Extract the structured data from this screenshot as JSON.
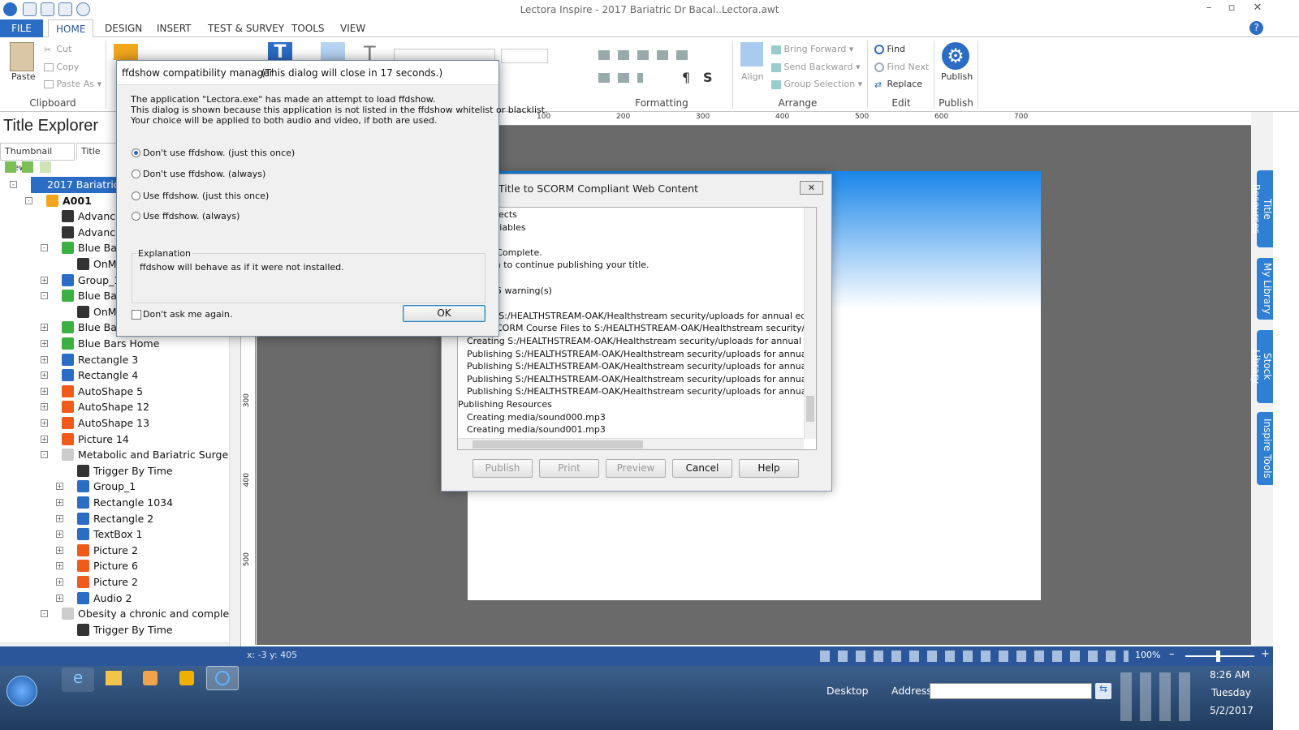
{
  "app": {
    "title": "Lectora Inspire - 2017 Bariatric Dr Bacal..Lectora.awt"
  },
  "window_buttons": {
    "minimize": "–",
    "restore": "▫",
    "close": "✕",
    "help": "?"
  },
  "tabs": [
    "FILE",
    "HOME",
    "DESIGN",
    "INSERT",
    "TEST & SURVEY",
    "TOOLS",
    "VIEW"
  ],
  "ribbon": {
    "clipboard": {
      "label": "Clipboard",
      "paste": "Paste",
      "cut": "Cut",
      "copy": "Copy",
      "paste_as": "Paste As"
    },
    "formatting": {
      "label": "Formatting"
    },
    "arrange": {
      "label": "Arrange",
      "align": "Align",
      "bring_forward": "Bring Forward",
      "send_backward": "Send Backward",
      "group_selection": "Group Selection"
    },
    "edit": {
      "label": "Edit",
      "find": "Find",
      "find_next": "Find Next",
      "replace": "Replace"
    },
    "publish": {
      "label": "Publish",
      "button": "Publish"
    }
  },
  "explorer": {
    "title": "Title Explorer",
    "tabs": [
      "Thumbnail View",
      "Title Expl"
    ],
    "tree": [
      {
        "label": "2017 Bariatric",
        "icon": "book",
        "selected": true
      },
      {
        "label": "A001",
        "icon": "folder",
        "bold": true
      },
      {
        "label": "Advance",
        "icon": "clapper"
      },
      {
        "label": "Advance",
        "icon": "clapper"
      },
      {
        "label": "Blue Bar",
        "icon": "green-screen"
      },
      {
        "label": "OnM",
        "icon": "clapper"
      },
      {
        "label": "Group_1",
        "icon": "group"
      },
      {
        "label": "Blue Bar",
        "icon": "green-screen"
      },
      {
        "label": "OnM",
        "icon": "clapper"
      },
      {
        "label": "Blue Bar",
        "icon": "green-screen"
      },
      {
        "label": "Blue Bars Home",
        "icon": "green-screen"
      },
      {
        "label": "Rectangle 3",
        "icon": "text"
      },
      {
        "label": "Rectangle 4",
        "icon": "text"
      },
      {
        "label": "AutoShape 5",
        "icon": "image"
      },
      {
        "label": "AutoShape 12",
        "icon": "image"
      },
      {
        "label": "AutoShape 13",
        "icon": "image"
      },
      {
        "label": "Picture 14",
        "icon": "image"
      },
      {
        "label": "Metabolic and Bariatric Surgery",
        "icon": "page"
      },
      {
        "label": "Trigger By Time",
        "icon": "clapper"
      },
      {
        "label": "Group_1",
        "icon": "group"
      },
      {
        "label": "Rectangle 1034",
        "icon": "text"
      },
      {
        "label": "Rectangle 2",
        "icon": "text"
      },
      {
        "label": "TextBox 1",
        "icon": "text"
      },
      {
        "label": "Picture 2",
        "icon": "image"
      },
      {
        "label": "Picture 6",
        "icon": "image"
      },
      {
        "label": "Picture 2",
        "icon": "image"
      },
      {
        "label": "Audio 2",
        "icon": "audio"
      },
      {
        "label": "Obesity a chronic and complex",
        "icon": "page"
      },
      {
        "label": "Trigger By Time",
        "icon": "clapper"
      }
    ]
  },
  "ruler": {
    "marks": [
      "100",
      "200",
      "300",
      "400",
      "500",
      "600",
      "700"
    ],
    "vmarks": [
      "300",
      "400",
      "500"
    ]
  },
  "side_tabs": [
    "Title Resources",
    "My Library",
    "Stock Library",
    "Inspire Tools"
  ],
  "scorm_dialog": {
    "title": "Title to SCORM Compliant Web Content",
    "log": [
      "bjects",
      "ariables",
      "",
      ": Complete.",
      "sh to continue publishing your title.",
      "",
      "95 warning(s)",
      "",
      "o S:/HEALTHSTREAM-OAK/Healthstream security/uploads for annual education",
      "SCORM Course Files to S:/HEALTHSTREAM-OAK/Healthstream security/uploads",
      "Creating S:/HEALTHSTREAM-OAK/Healthstream security/uploads for annual education/f",
      "Publishing S:/HEALTHSTREAM-OAK/Healthstream security/uploads for annual education,",
      "Publishing S:/HEALTHSTREAM-OAK/Healthstream security/uploads for annual education,",
      "Publishing S:/HEALTHSTREAM-OAK/Healthstream security/uploads for annual education,",
      "Publishing S:/HEALTHSTREAM-OAK/Healthstream security/uploads for annual education,",
      "Publishing Resources",
      "Creating media/sound000.mp3",
      "Creating media/sound001.mp3"
    ],
    "buttons": {
      "publish": "Publish",
      "print": "Print",
      "preview": "Preview",
      "cancel": "Cancel",
      "help": "Help"
    },
    "close": "✕"
  },
  "ffdshow_dialog": {
    "title": "ffdshow compatibility manager",
    "countdown": "(This dialog will close in 17 seconds.)",
    "message": [
      "The application \"Lectora.exe\" has made an attempt to load ffdshow.",
      "This dialog is shown because this application is not listed in the ffdshow whitelist or blacklist.",
      "Your choice will be applied to both audio and video, if both are used."
    ],
    "options": [
      {
        "label": "Don't use ffdshow. (just this once)",
        "selected": true
      },
      {
        "label": "Don't use ffdshow. (always)",
        "selected": false
      },
      {
        "label": "Use ffdshow. (just this once)",
        "selected": false
      },
      {
        "label": "Use ffdshow. (always)",
        "selected": false
      }
    ],
    "explanation_label": "Explanation",
    "explanation_text": "ffdshow will behave as if it were not installed.",
    "dont_ask": "Don't ask me again.",
    "ok": "OK"
  },
  "status": {
    "coords": "x: -3  y: 405",
    "zoom": "100%",
    "zoom_out": "–",
    "zoom_in": "+"
  },
  "taskbar": {
    "desktop": "Desktop",
    "address_label": "Address",
    "address_value": "",
    "time": "8:26 AM",
    "day": "Tuesday",
    "date": "5/2/2017"
  }
}
